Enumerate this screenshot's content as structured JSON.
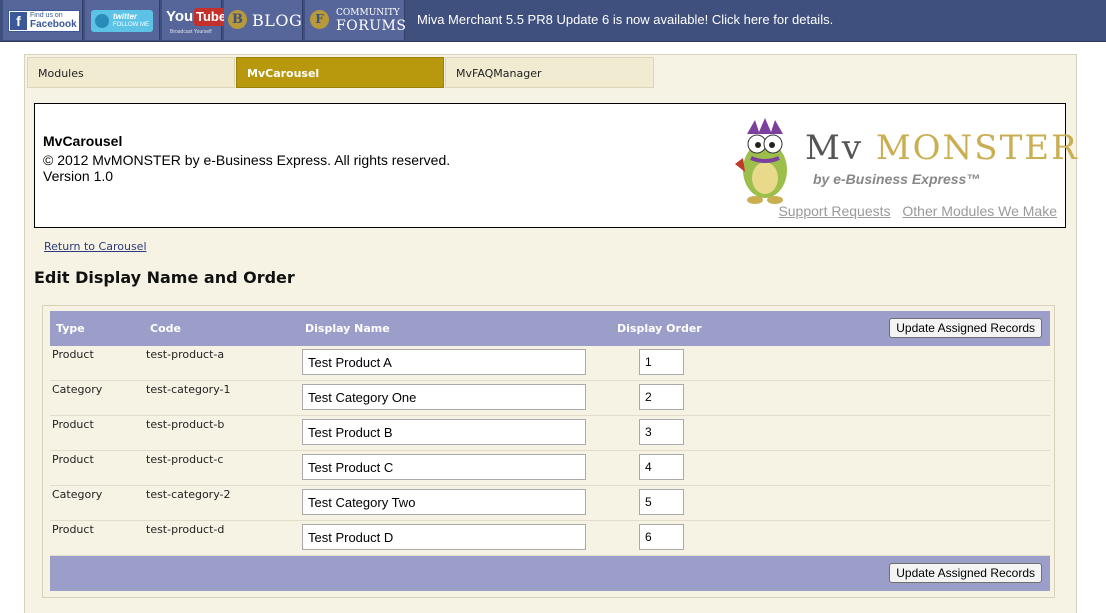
{
  "topbar": {
    "facebook": {
      "line1": "Find us on",
      "line2": "Facebook"
    },
    "twitter": {
      "line1": "twitter",
      "line2": "FOLLOW ME"
    },
    "youtube": {
      "you": "You",
      "tube": "Tube",
      "tagline": "Broadcast Yourself"
    },
    "blog": {
      "label": "BLOG"
    },
    "forums": {
      "line1": "COMMUNITY",
      "line2": "FORUMS"
    },
    "announcement": "Miva Merchant 5.5 PR8 Update 6 is now available! Click here for details."
  },
  "tabs": [
    {
      "label": "Modules"
    },
    {
      "label": "MvCarousel",
      "active": true
    },
    {
      "label": "MvFAQManager"
    }
  ],
  "header": {
    "title": "MvCarousel",
    "copyright": "© 2012 MvMONSTER by e-Business Express. All rights reserved.",
    "version": "Version 1.0",
    "logo_mv": "Mv",
    "logo_monster": "MONSTER",
    "logo_by": "by e-Business Express™",
    "links": [
      "Support Requests",
      "Other Modules We Make"
    ]
  },
  "nav": {
    "return_link": "Return to Carousel"
  },
  "section_title": "Edit Display Name and Order",
  "table": {
    "columns": [
      "Type",
      "Code",
      "Display Name",
      "Display Order"
    ],
    "update_button": "Update Assigned Records",
    "rows": [
      {
        "type": "Product",
        "code": "test-product-a",
        "name": "Test Product A",
        "order": "1"
      },
      {
        "type": "Category",
        "code": "test-category-1",
        "name": "Test Category One",
        "order": "2"
      },
      {
        "type": "Product",
        "code": "test-product-b",
        "name": "Test Product B",
        "order": "3"
      },
      {
        "type": "Product",
        "code": "test-product-c",
        "name": "Test Product C",
        "order": "4"
      },
      {
        "type": "Category",
        "code": "test-category-2",
        "name": "Test Category Two",
        "order": "5"
      },
      {
        "type": "Product",
        "code": "test-product-d",
        "name": "Test Product D",
        "order": "6"
      }
    ]
  },
  "colors": {
    "accent_gold": "#b8980c",
    "table_header": "#9b9ec9",
    "topbar": "#3f4f7e",
    "panel": "#f6f3e5"
  }
}
